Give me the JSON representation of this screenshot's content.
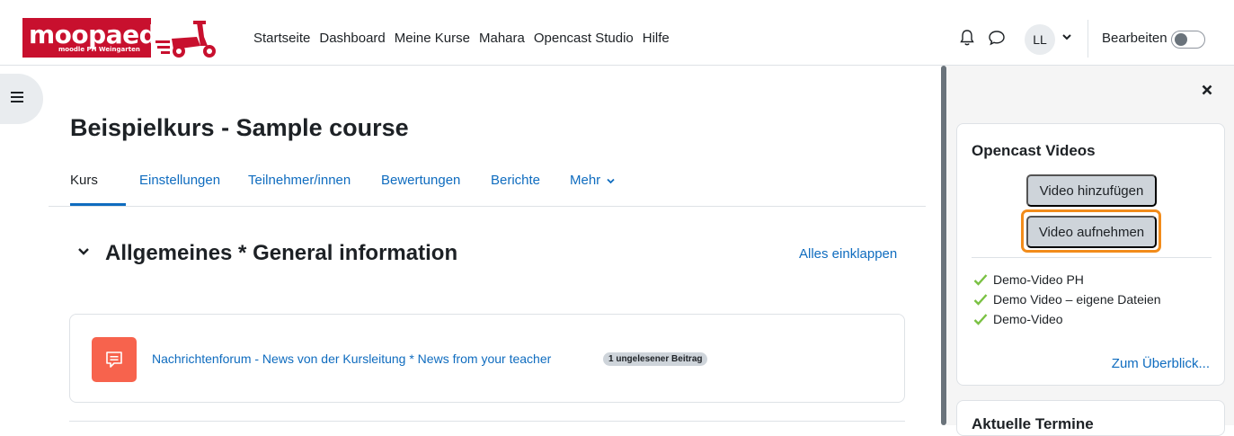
{
  "brand": {
    "logo_text": "moopaed",
    "logo_sub": "moodle PH Weingarten"
  },
  "nav": {
    "items": [
      {
        "label": "Startseite"
      },
      {
        "label": "Dashboard"
      },
      {
        "label": "Meine Kurse"
      },
      {
        "label": "Mahara"
      },
      {
        "label": "Opencast Studio"
      },
      {
        "label": "Hilfe"
      }
    ]
  },
  "user": {
    "initials": "LL",
    "edit_label": "Bearbeiten",
    "edit_mode_on": false
  },
  "course": {
    "title": "Beispielkurs - Sample course",
    "tabs": [
      {
        "label": "Kurs",
        "active": true
      },
      {
        "label": "Einstellungen"
      },
      {
        "label": "Teilnehmer/innen"
      },
      {
        "label": "Bewertungen"
      },
      {
        "label": "Berichte"
      },
      {
        "label": "Mehr"
      }
    ]
  },
  "section": {
    "title": "Allgemeines * General information",
    "collapse_all": "Alles einklappen"
  },
  "activity": {
    "forum_link": "Nachrichtenforum - News von der Kursleitung * News from your teacher",
    "unread_badge": "1 ungelesener Beitrag"
  },
  "opencast_block": {
    "title": "Opencast Videos",
    "add_video": "Video hinzufügen",
    "record_video": "Video aufnehmen",
    "videos": [
      {
        "title": "Demo-Video PH"
      },
      {
        "title": "Demo Video – eigene Dateien"
      },
      {
        "title": "Demo-Video"
      }
    ],
    "overview_link": "Zum Überblick..."
  },
  "next_block": {
    "title": "Aktuelle Termine"
  },
  "colors": {
    "brand_red": "#c8102e",
    "link_blue": "#0f6cbf",
    "forum_orange": "#f7634d",
    "highlight_orange": "#f28c1b",
    "check_green": "#7ac143"
  }
}
